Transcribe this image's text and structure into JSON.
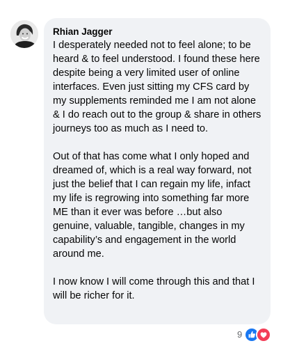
{
  "comment": {
    "author": "Rhian Jagger",
    "paragraphs": [
      "I desperately needed not to feel alone; to be heard & to feel understood. I found these here despite being a very limited user of online interfaces. Even just sitting my CFS card by my supplements reminded me I am not alone & I do reach out to the group & share in others journeys too as much as I need to.",
      "Out of that has come what I only hoped and dreamed of, which is a real way forward, not just the belief that I can regain my life, infact my life is regrowing into something far more ME than it ever was before …but also genuine, valuable, tangible, changes in my capability’s and engagement in the world around me.",
      "I now know I will come through this and that I will be richer for it."
    ],
    "reactions": {
      "count": "9",
      "types": [
        "like-icon",
        "love-icon"
      ]
    }
  },
  "colors": {
    "bubble": "#f0f2f5",
    "text": "#050505",
    "secondary_text": "#65676b",
    "like": "#1877f2",
    "love": "#f33e58"
  }
}
